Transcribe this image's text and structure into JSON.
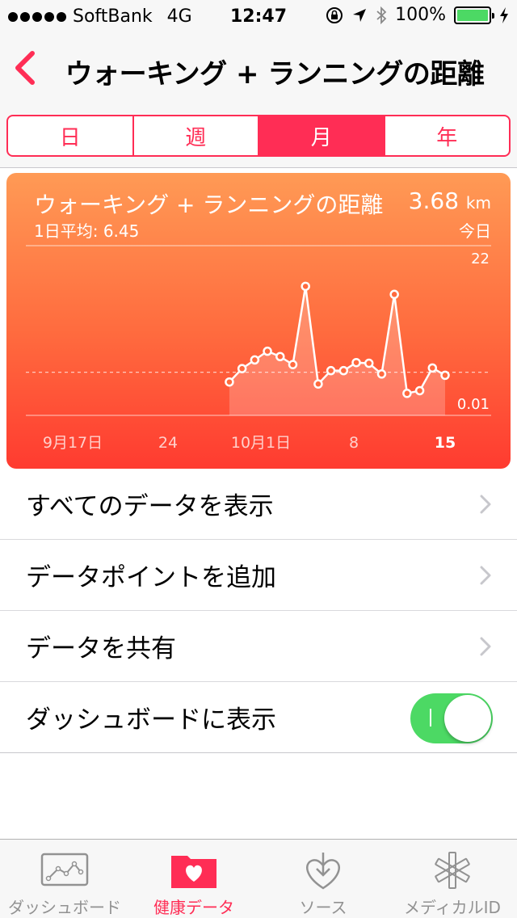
{
  "status_bar": {
    "carrier": "SoftBank",
    "network": "4G",
    "time": "12:47",
    "battery": "100%",
    "signal_bars": 5
  },
  "nav": {
    "title": "ウォーキング + ランニングの距離"
  },
  "segments": [
    {
      "label": "日",
      "active": false
    },
    {
      "label": "週",
      "active": false
    },
    {
      "label": "月",
      "active": true
    },
    {
      "label": "年",
      "active": false
    }
  ],
  "card": {
    "title": "ウォーキング + ランニングの距離",
    "value": "3.68",
    "unit": "km",
    "subtitle": "1日平均: 6.45",
    "today": "今日"
  },
  "chart_data": {
    "type": "line",
    "ylim": [
      0.01,
      22
    ],
    "y_max_label": "22",
    "y_min_label": "0.01",
    "average": 6.45,
    "x_tick_labels": [
      {
        "label": "9月17日",
        "day": 0,
        "bold": false
      },
      {
        "label": "24",
        "day": 7,
        "bold": false
      },
      {
        "label": "10月1日",
        "day": 14,
        "bold": false
      },
      {
        "label": "8",
        "day": 21,
        "bold": false
      },
      {
        "label": "15",
        "day": 28,
        "bold": true
      }
    ],
    "x_range": [
      0,
      28
    ],
    "points": [
      {
        "day": 14,
        "value": 5.0
      },
      {
        "day": 15,
        "value": 7.0
      },
      {
        "day": 16,
        "value": 8.3
      },
      {
        "day": 17,
        "value": 9.6
      },
      {
        "day": 18,
        "value": 8.8
      },
      {
        "day": 19,
        "value": 7.6
      },
      {
        "day": 20,
        "value": 19.3
      },
      {
        "day": 21,
        "value": 4.7
      },
      {
        "day": 22,
        "value": 6.7
      },
      {
        "day": 23,
        "value": 6.7
      },
      {
        "day": 24,
        "value": 7.9
      },
      {
        "day": 25,
        "value": 7.8
      },
      {
        "day": 26,
        "value": 6.2
      },
      {
        "day": 27,
        "value": 18.1
      },
      {
        "day": 28,
        "value": 3.3
      },
      {
        "day": 29,
        "value": 3.7
      },
      {
        "day": 30,
        "value": 7.1
      },
      {
        "day": 31,
        "value": 6.0
      }
    ]
  },
  "list": {
    "show_all": "すべてのデータを表示",
    "add_point": "データポイントを追加",
    "share": "データを共有",
    "show_on_dashboard": "ダッシュボードに表示",
    "dashboard_toggle_on": true
  },
  "tabs": [
    {
      "label": "ダッシュボード",
      "icon": "dashboard-chart-icon",
      "active": false
    },
    {
      "label": "健康データ",
      "icon": "health-data-folder-icon",
      "active": true
    },
    {
      "label": "ソース",
      "icon": "sources-download-heart-icon",
      "active": false
    },
    {
      "label": "メディカルID",
      "icon": "medical-id-asterisk-icon",
      "active": false
    }
  ],
  "colors": {
    "accent": "#ff2d55",
    "toggle_on": "#4cd964",
    "card_top": "#ff9a55",
    "card_bottom": "#ff3b30"
  }
}
